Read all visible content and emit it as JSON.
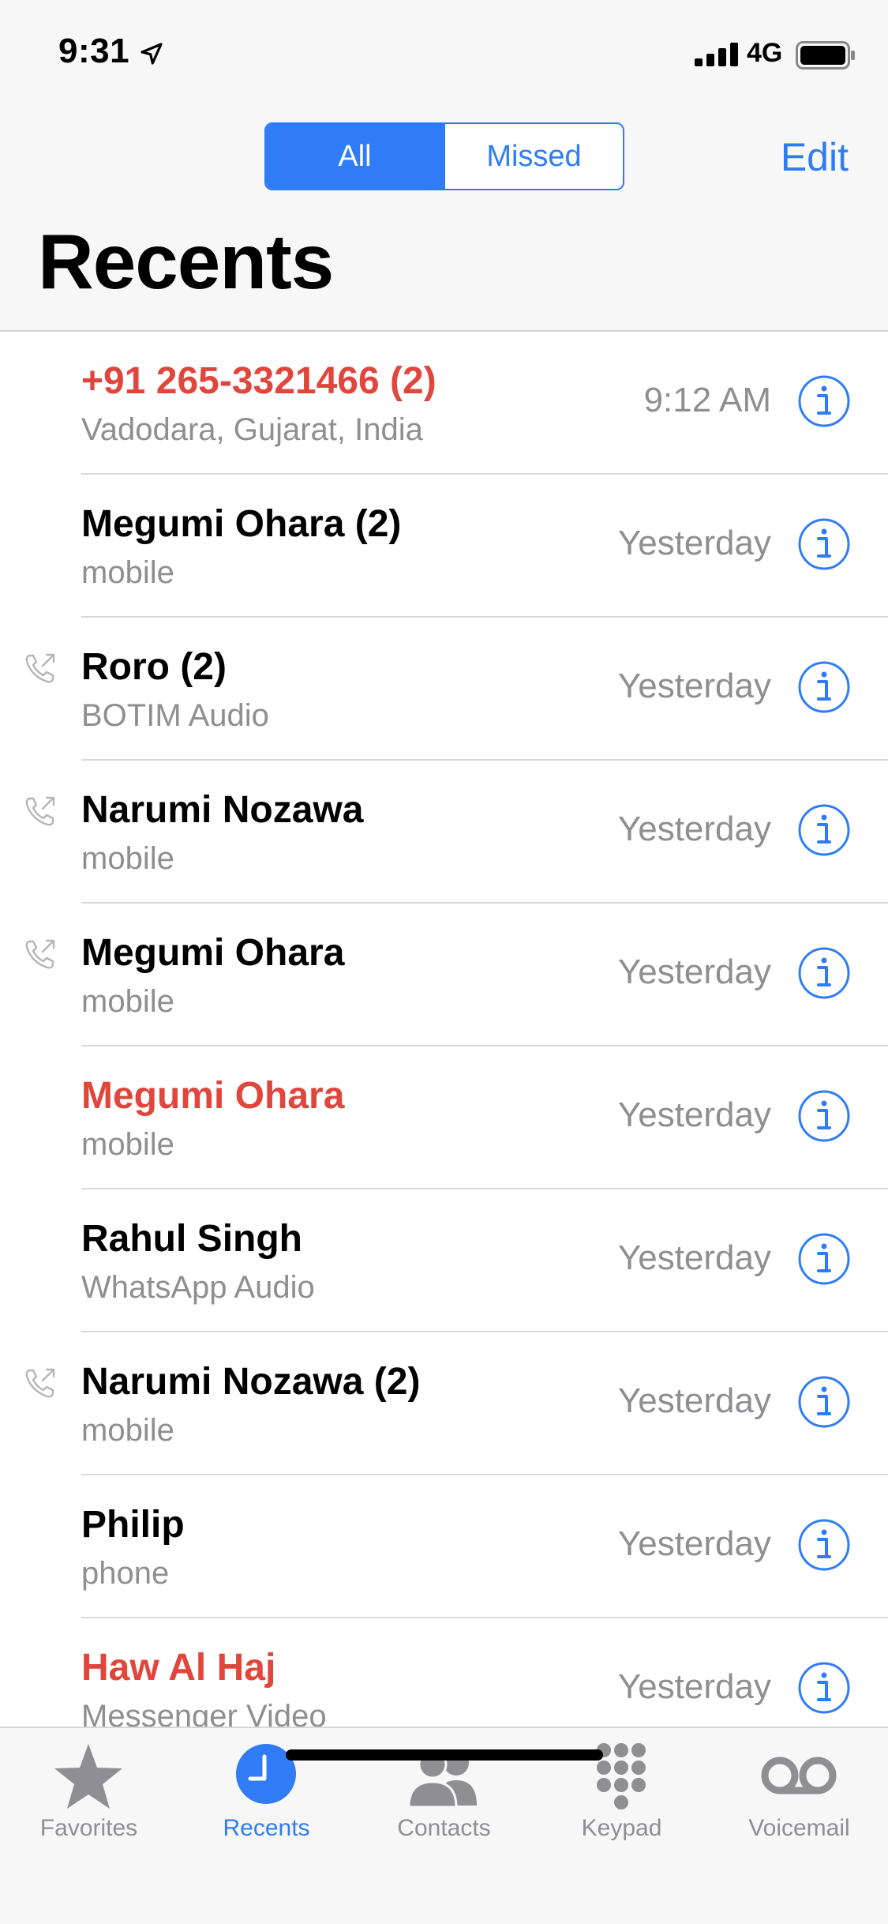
{
  "status_bar": {
    "time": "9:31",
    "network": "4G",
    "location_icon": "location-arrow-icon",
    "signal_icon": "cellular-signal-icon",
    "battery_icon": "battery-icon"
  },
  "header": {
    "segments": [
      {
        "label": "All",
        "selected": true
      },
      {
        "label": "Missed",
        "selected": false
      }
    ],
    "edit_label": "Edit",
    "title": "Recents"
  },
  "colors": {
    "accent": "#2f7cf6",
    "missed": "#e0463c",
    "secondary_text": "#8e8e93"
  },
  "calls": [
    {
      "name": "+91 265-3321466 (2)",
      "type": "Vadodara, Gujarat, India",
      "time": "9:12 AM",
      "missed": true,
      "outgoing": false
    },
    {
      "name": "Megumi Ohara (2)",
      "type": "mobile",
      "time": "Yesterday",
      "missed": false,
      "outgoing": false
    },
    {
      "name": "Roro (2)",
      "type": "BOTIM Audio",
      "time": "Yesterday",
      "missed": false,
      "outgoing": true
    },
    {
      "name": "Narumi Nozawa",
      "type": "mobile",
      "time": "Yesterday",
      "missed": false,
      "outgoing": true
    },
    {
      "name": "Megumi Ohara",
      "type": "mobile",
      "time": "Yesterday",
      "missed": false,
      "outgoing": true
    },
    {
      "name": "Megumi Ohara",
      "type": "mobile",
      "time": "Yesterday",
      "missed": true,
      "outgoing": false
    },
    {
      "name": "Rahul Singh",
      "type": "WhatsApp Audio",
      "time": "Yesterday",
      "missed": false,
      "outgoing": false
    },
    {
      "name": "Narumi Nozawa (2)",
      "type": "mobile",
      "time": "Yesterday",
      "missed": false,
      "outgoing": true
    },
    {
      "name": "Philip",
      "type": "phone",
      "time": "Yesterday",
      "missed": false,
      "outgoing": false
    },
    {
      "name": "Haw Al Haj",
      "type": "Messenger Video",
      "time": "Yesterday",
      "missed": true,
      "outgoing": false
    }
  ],
  "tabbar": {
    "tabs": [
      {
        "label": "Favorites",
        "icon": "star-icon",
        "active": false
      },
      {
        "label": "Recents",
        "icon": "clock-icon",
        "active": true
      },
      {
        "label": "Contacts",
        "icon": "contacts-icon",
        "active": false
      },
      {
        "label": "Keypad",
        "icon": "keypad-icon",
        "active": false
      },
      {
        "label": "Voicemail",
        "icon": "voicemail-icon",
        "active": false
      }
    ]
  }
}
